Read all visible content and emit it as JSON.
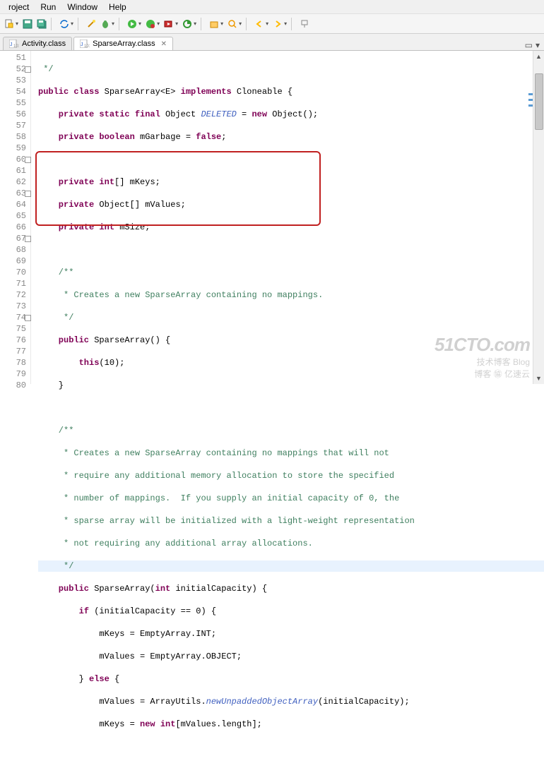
{
  "menu": {
    "m0": "roject",
    "m1": "Run",
    "m2": "Window",
    "m3": "Help"
  },
  "tabs": {
    "t0": "Activity.class",
    "t1": "SparseArray.class"
  },
  "lines": {
    "n51": "51",
    "n52": "52",
    "n53": "53",
    "n54": "54",
    "n55": "55",
    "n56": "56",
    "n57": "57",
    "n58": "58",
    "n59": "59",
    "n60": "60",
    "n61": "61",
    "n62": "62",
    "n63": "63",
    "n64": "64",
    "n65": "65",
    "n66": "66",
    "n67": "67",
    "n68": "68",
    "n69": "69",
    "n70": "70",
    "n71": "71",
    "n72": "72",
    "n73": "73",
    "n74": "74",
    "n75": "75",
    "n76": "76",
    "n77": "77",
    "n78": "78",
    "n79": "79",
    "n80": "80"
  },
  "code": {
    "c51": " */",
    "c52a": "public",
    "c52b": " class",
    "c52c": " SparseArray<E> ",
    "c52d": "implements",
    "c52e": " Cloneable {",
    "c53a": "    private static final",
    "c53b": " Object ",
    "c53c": "DELETED",
    "c53d": " = ",
    "c53e": "new",
    "c53f": " Object();",
    "c54a": "    private boolean",
    "c54b": " mGarbage = ",
    "c54c": "false",
    "c54d": ";",
    "c56a": "    private int",
    "c56b": "[] mKeys;",
    "c57a": "    private",
    "c57b": " Object[] mValues;",
    "c58a": "    private int",
    "c58b": " mSize;",
    "c60": "    /**",
    "c61": "     * Creates a new SparseArray containing no mappings.",
    "c62": "     */",
    "c63a": "    public",
    "c63b": " SparseArray() {",
    "c64a": "        this",
    "c64b": "(10);",
    "c65": "    }",
    "c67": "    /**",
    "c68": "     * Creates a new SparseArray containing no mappings that will not",
    "c69": "     * require any additional memory allocation to store the specified",
    "c70": "     * number of mappings.  If you supply an initial capacity of 0, the",
    "c71": "     * sparse array will be initialized with a light-weight representation",
    "c72": "     * not requiring any additional array allocations.",
    "c73": "     */",
    "c74a": "    public",
    "c74b": " SparseArray(",
    "c74c": "int",
    "c74d": " initialCapacity) {",
    "c75a": "        if",
    "c75b": " (initialCapacity == 0) {",
    "c76": "            mKeys = EmptyArray.INT;",
    "c77": "            mValues = EmptyArray.OBJECT;",
    "c78a": "        } ",
    "c78b": "else",
    "c78c": " {",
    "c79a": "            mValues = ArrayUtils.",
    "c79b": "newUnpaddedObjectArray",
    "c79c": "(initialCapacity);",
    "c80a": "            mKeys = ",
    "c80b": "new int",
    "c80c": "[mValues.length];"
  },
  "watermark": {
    "big": "51CTO.com",
    "sub1": "技术博客  Blog",
    "sub2": "博客 ㊯ 亿速云"
  }
}
